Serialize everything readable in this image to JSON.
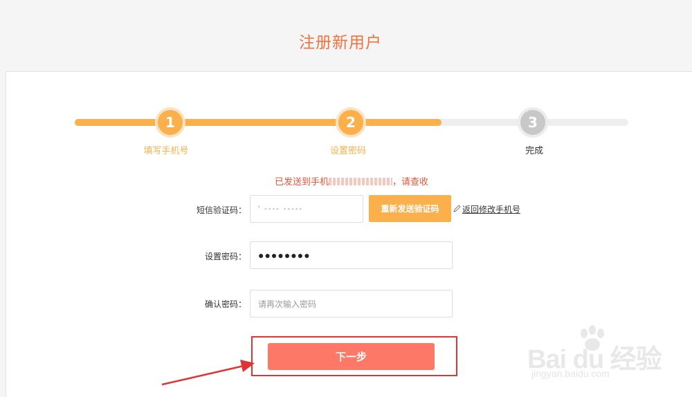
{
  "header": {
    "title": "注册新用户"
  },
  "steps": [
    {
      "number": "1",
      "label": "填写手机号",
      "state": "done"
    },
    {
      "number": "2",
      "label": "设置密码",
      "state": "current"
    },
    {
      "number": "3",
      "label": "完成",
      "state": "todo"
    }
  ],
  "progress": {
    "fraction": 0.66
  },
  "notice": {
    "prefix": "已发送到手机",
    "suffix": "，请查收"
  },
  "form": {
    "sms_label": "短信验证码：",
    "sms_value": "' ---- -----",
    "resend_label": "重新发送验证码",
    "edit_phone_label": "返回修改手机号",
    "password_label": "设置密码：",
    "password_value": "●●●●●●●●",
    "confirm_label": "确认密码：",
    "confirm_placeholder": "请再次输入密码"
  },
  "actions": {
    "next_label": "下一步"
  },
  "watermark": {
    "brand": "Bai du 经验",
    "url": "jingyan.baidu.com"
  },
  "colors": {
    "accent": "#fbb04c",
    "title": "#f0733f",
    "notice": "#e8553a",
    "next_button": "#fd7866",
    "annotation": "#e03434"
  }
}
